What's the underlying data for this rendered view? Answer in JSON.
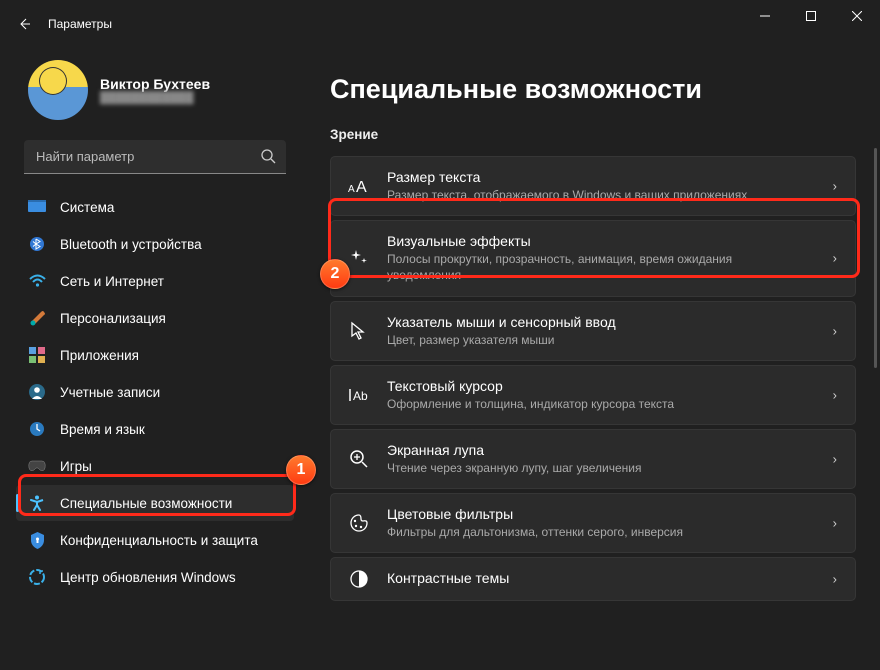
{
  "titlebar": {
    "app_title": "Параметры"
  },
  "profile": {
    "name": "Виктор Бухтеев"
  },
  "search": {
    "placeholder": "Найти параметр"
  },
  "sidebar": {
    "items": [
      {
        "label": "Система"
      },
      {
        "label": "Bluetooth и устройства"
      },
      {
        "label": "Сеть и Интернет"
      },
      {
        "label": "Персонализация"
      },
      {
        "label": "Приложения"
      },
      {
        "label": "Учетные записи"
      },
      {
        "label": "Время и язык"
      },
      {
        "label": "Игры"
      },
      {
        "label": "Специальные возможности"
      },
      {
        "label": "Конфиденциальность и защита"
      },
      {
        "label": "Центр обновления Windows"
      }
    ]
  },
  "main": {
    "title": "Специальные возможности",
    "section": "Зрение",
    "cards": [
      {
        "title": "Размер текста",
        "desc": "Размер текста, отображаемого в Windows и ваших приложениях"
      },
      {
        "title": "Визуальные эффекты",
        "desc": "Полосы прокрутки, прозрачность, анимация, время ожидания уведомления"
      },
      {
        "title": "Указатель мыши и сенсорный ввод",
        "desc": "Цвет, размер указателя мыши"
      },
      {
        "title": "Текстовый курсор",
        "desc": "Оформление и толщина, индикатор курсора текста"
      },
      {
        "title": "Экранная лупа",
        "desc": "Чтение через экранную лупу, шаг увеличения"
      },
      {
        "title": "Цветовые фильтры",
        "desc": "Фильтры для дальтонизма, оттенки серого, инверсия"
      },
      {
        "title": "Контрастные темы",
        "desc": ""
      }
    ]
  },
  "annotations": {
    "badge1": "1",
    "badge2": "2"
  }
}
